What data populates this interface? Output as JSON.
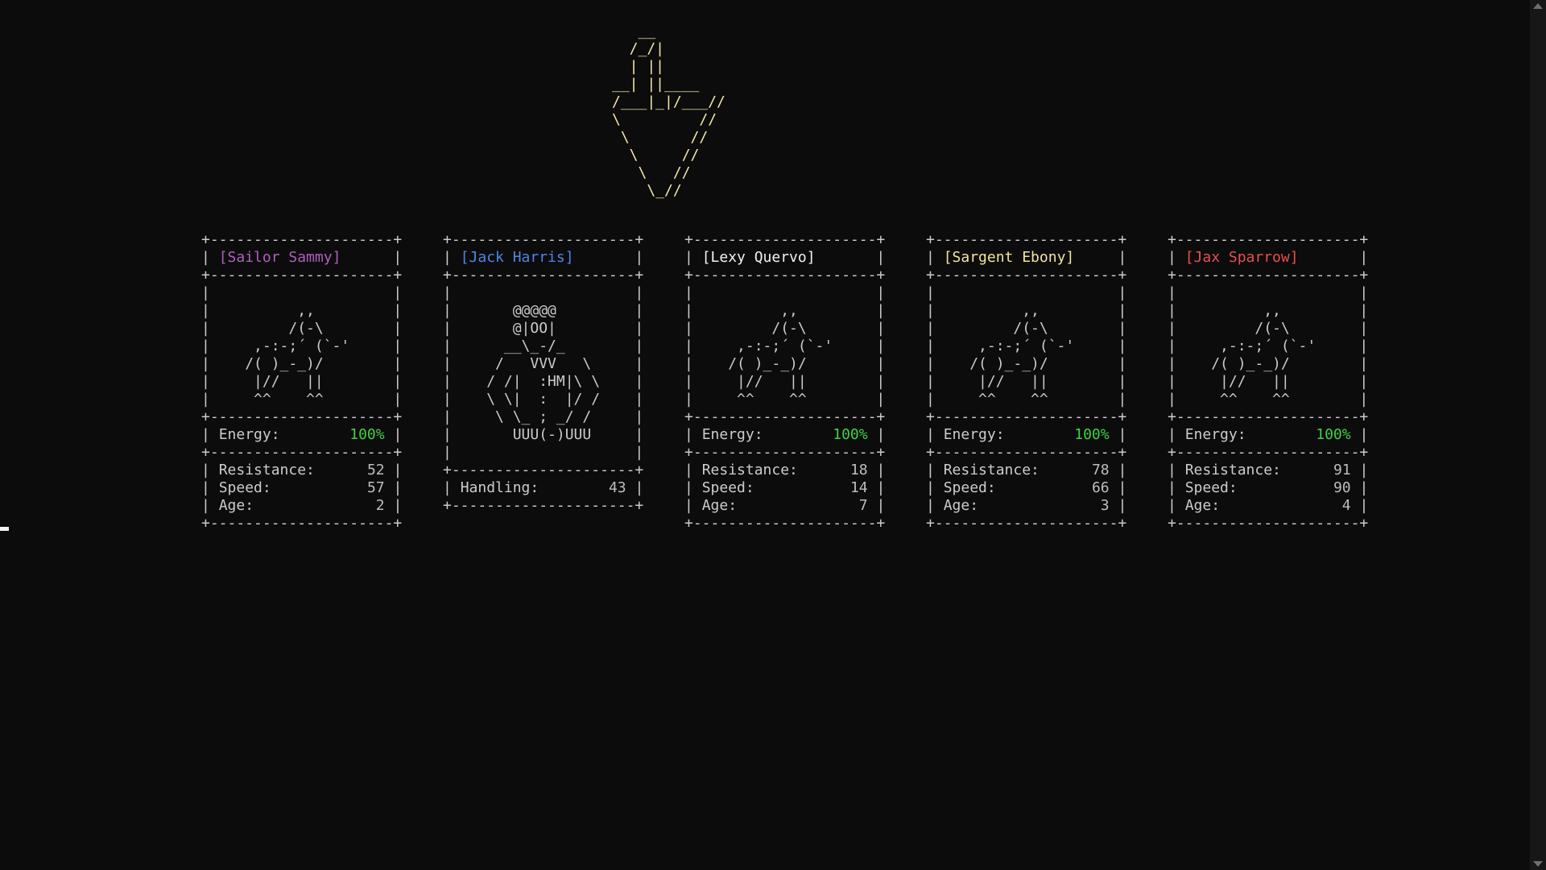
{
  "logo_art": "   __\n  /_/|\n  | ||\n__| ||____\n/___|_|/___//\n\\         //\n \\       //\n  \\     //\n   \\   //\n    \\_//",
  "colors": {
    "background": "#0c0c0c",
    "text": "#cccccc",
    "logo": "#f5e6a8",
    "energy": "#3fd147",
    "name_purple": "#b15fc0",
    "name_blue": "#4f86e8",
    "name_white": "#f2f2f2",
    "name_yellow": "#f4e4a0",
    "name_red": "#e7504f"
  },
  "cards": [
    {
      "name": "[Sailor Sammy]",
      "color": "purple",
      "art": [
        "          ,,",
        "         /(-\\",
        "     ,-:-;´ (`-'",
        "    /( )_-_)/",
        "     |//   ||",
        "     ^^    ^^"
      ],
      "energy_label": "Energy:",
      "energy_value": "100%",
      "stats": [
        {
          "label": "Resistance:",
          "value": "52"
        },
        {
          "label": "Speed:",
          "value": "57"
        },
        {
          "label": "Age:",
          "value": "2"
        }
      ]
    },
    {
      "name": "[Jack Harris]",
      "color": "blue",
      "art": [
        "",
        "       @@@@@",
        "       @|OO|",
        "      __\\_-/_",
        "     /   VVV   \\",
        "    / /|  :HM|\\ \\",
        "    \\ \\|  :  |/ /",
        "     \\ \\_ ; _/ /",
        "       UUU(-)UUU",
        ""
      ],
      "stats": [
        {
          "label": "Handling:",
          "value": "43"
        }
      ]
    },
    {
      "name": "[Lexy Quervo]",
      "color": "white",
      "art": [
        "          ,,",
        "         /(-\\",
        "     ,-:-;´ (`-'",
        "    /( )_-_)/",
        "     |//   ||",
        "     ^^    ^^"
      ],
      "energy_label": "Energy:",
      "energy_value": "100%",
      "stats": [
        {
          "label": "Resistance:",
          "value": "18"
        },
        {
          "label": "Speed:",
          "value": "14"
        },
        {
          "label": "Age:",
          "value": "7"
        }
      ]
    },
    {
      "name": "[Sargent Ebony]",
      "color": "yellow",
      "art": [
        "          ,,",
        "         /(-\\",
        "     ,-:-;´ (`-'",
        "    /( )_-_)/",
        "     |//   ||",
        "     ^^    ^^"
      ],
      "energy_label": "Energy:",
      "energy_value": "100%",
      "stats": [
        {
          "label": "Resistance:",
          "value": "78"
        },
        {
          "label": "Speed:",
          "value": "66"
        },
        {
          "label": "Age:",
          "value": "3"
        }
      ]
    },
    {
      "name": "[Jax Sparrow]",
      "color": "red",
      "art": [
        "          ,,",
        "         /(-\\",
        "     ,-:-;´ (`-'",
        "    /( )_-_)/",
        "     |//   ||",
        "     ^^    ^^"
      ],
      "energy_label": "Energy:",
      "energy_value": "100%",
      "stats": [
        {
          "label": "Resistance:",
          "value": "91"
        },
        {
          "label": "Speed:",
          "value": "90"
        },
        {
          "label": "Age:",
          "value": "4"
        }
      ]
    }
  ]
}
